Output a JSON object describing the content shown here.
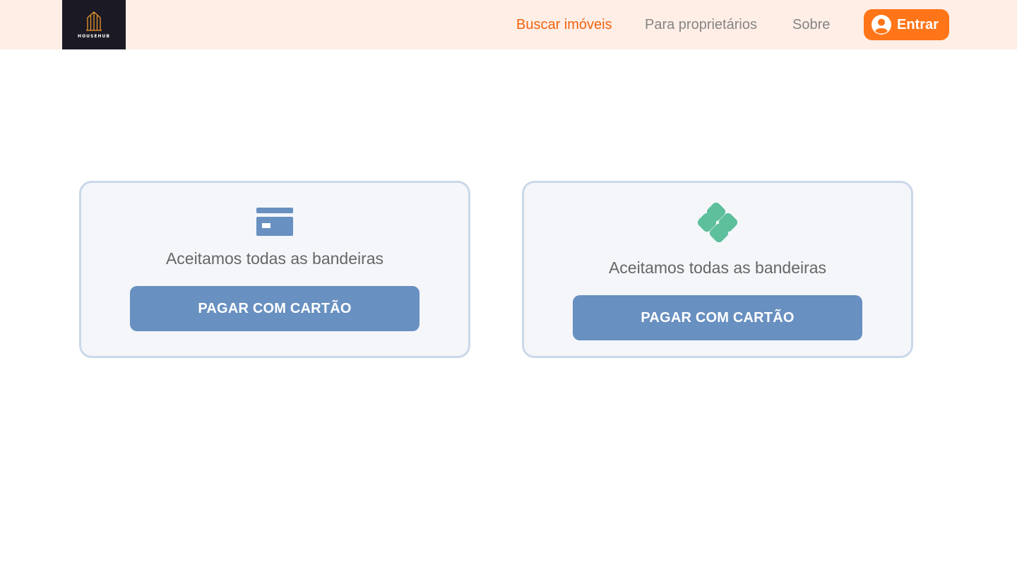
{
  "header": {
    "logo_text": "HOUSEHUB",
    "nav": [
      {
        "label": "Buscar imóveis",
        "active": true
      },
      {
        "label": "Para proprietários",
        "active": false
      },
      {
        "label": "Sobre",
        "active": false
      }
    ],
    "login_label": "Entrar"
  },
  "payment_options": [
    {
      "icon": "credit-card-icon",
      "text": "Aceitamos todas as bandeiras",
      "button_label": "PAGAR COM CARTÃO"
    },
    {
      "icon": "pix-icon",
      "text": "Aceitamos todas as bandeiras",
      "button_label": "PAGAR COM CARTÃO"
    }
  ],
  "colors": {
    "header_bg": "#ffeee6",
    "accent": "#f06410",
    "login_button": "#ff7518",
    "card_bg": "#f4f6fa",
    "card_border": "#cad8e9",
    "pay_button": "#6890c0",
    "credit_card_icon": "#6890c0",
    "pix_icon": "#5dbf9b"
  }
}
